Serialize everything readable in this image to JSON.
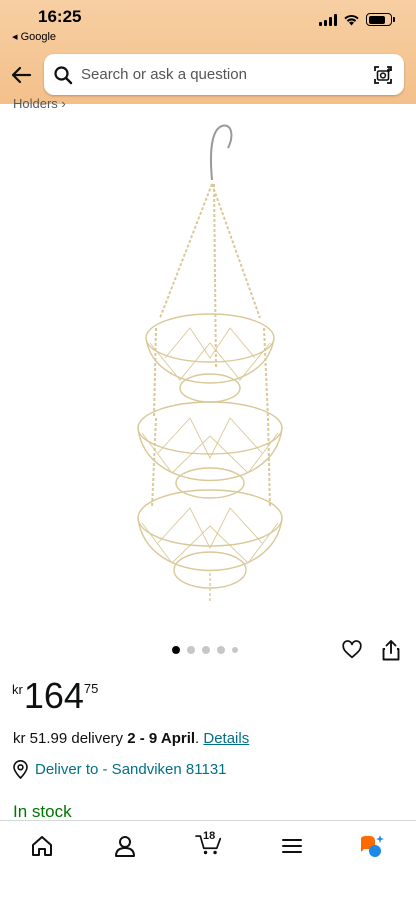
{
  "status_bar": {
    "time": "16:25",
    "back_app": "◂ Google"
  },
  "header": {
    "search_placeholder": "Search or ask a question"
  },
  "breadcrumb_partial": "Holders ›",
  "product": {
    "image_alt": "3-tier hanging wire fruit basket",
    "carousel": {
      "total": 5,
      "active_index": 0
    }
  },
  "price": {
    "currency": "kr",
    "whole": "164",
    "fraction": "75"
  },
  "delivery": {
    "fee": "kr 51.99 delivery",
    "dates": "2 - 9 April",
    "details_link": "Details"
  },
  "location": {
    "label": "Deliver to - Sandviken 81131"
  },
  "stock": {
    "status": "In stock"
  },
  "bottom_nav": {
    "cart_count": "18",
    "items": [
      "home",
      "account",
      "cart",
      "menu",
      "rufus"
    ]
  },
  "colors": {
    "header": "#f3c08a",
    "link": "#007185",
    "in_stock": "#007600",
    "rufus_orange": "#ff6a00",
    "rufus_blue": "#1e88e5"
  }
}
